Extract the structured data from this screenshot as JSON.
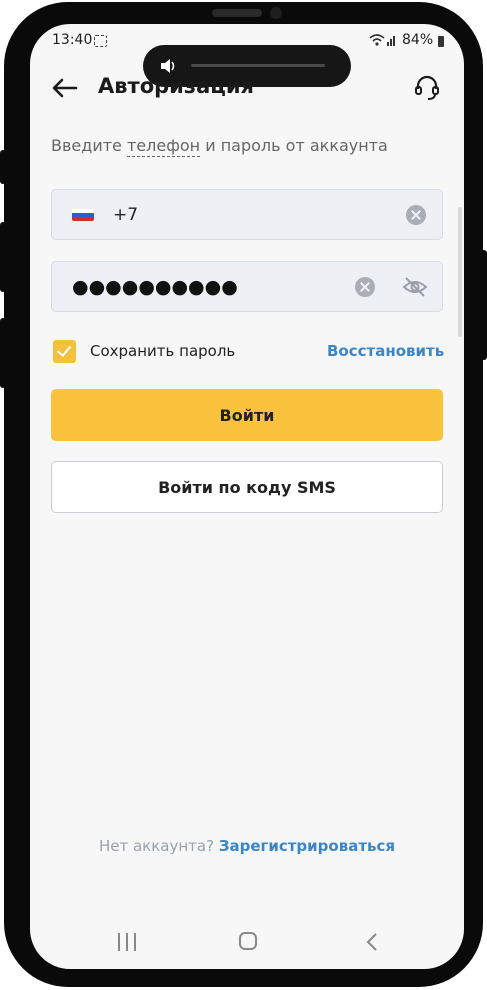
{
  "status_bar": {
    "time": "13:40",
    "battery": "84%"
  },
  "header": {
    "title": "Авторизация"
  },
  "subtitle": {
    "before": "Введите ",
    "phone_word": "телефон",
    "after": " и пароль от аккаунта"
  },
  "phone_field": {
    "country_code": "+7",
    "value": ""
  },
  "password_field": {
    "value": "●●●●●●●●●●"
  },
  "remember": {
    "label": "Сохранить пароль",
    "checked": true
  },
  "restore_link": "Восстановить",
  "login_button": "Войти",
  "sms_button": "Войти по коду SMS",
  "footer": {
    "no_account": "Нет аккаунта?",
    "register": "Зарегистрироваться"
  },
  "colors": {
    "accent": "#fbc23d",
    "link": "#3a86c8"
  }
}
